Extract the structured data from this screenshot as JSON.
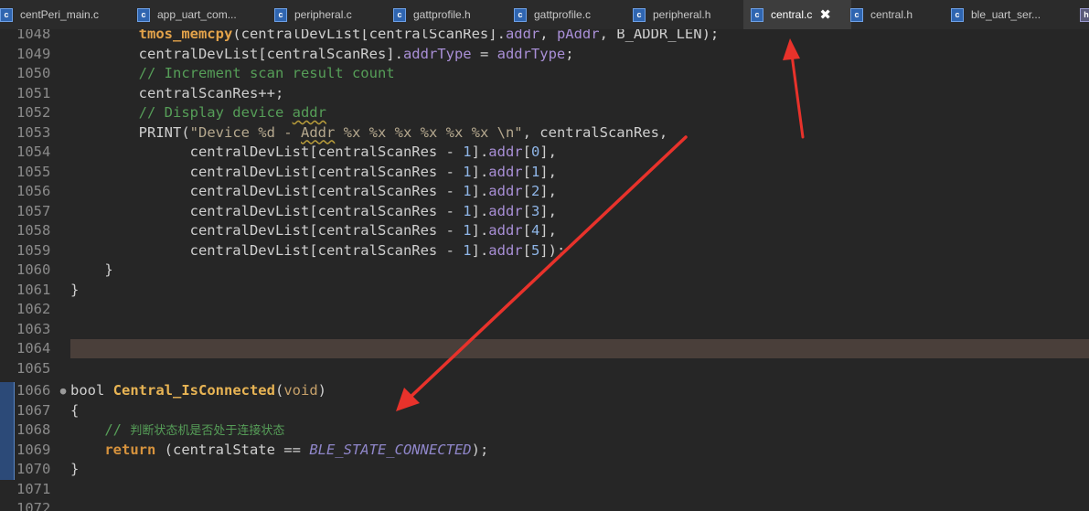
{
  "tabs": [
    {
      "label": "centPeri_main.c",
      "icon": "c-file-icon",
      "active": false
    },
    {
      "label": "app_uart_com...",
      "icon": "c-file-icon",
      "active": false
    },
    {
      "label": "peripheral.c",
      "icon": "c-file-icon",
      "active": false
    },
    {
      "label": "gattprofile.h",
      "icon": "c-file-icon",
      "active": false
    },
    {
      "label": "gattprofile.c",
      "icon": "c-file-icon",
      "active": false
    },
    {
      "label": "peripheral.h",
      "icon": "c-file-icon",
      "active": false
    },
    {
      "label": "central.c",
      "icon": "c-file-icon",
      "active": true,
      "close": "✖"
    },
    {
      "label": "central.h",
      "icon": "c-file-icon",
      "active": false
    },
    {
      "label": "ble_uart_ser...",
      "icon": "c-file-icon",
      "active": false
    },
    {
      "label": "",
      "icon": "h-file-icon",
      "active": false
    }
  ],
  "editor": {
    "line_numbers": [
      "1048",
      "1049",
      "1050",
      "1051",
      "1052",
      "1053",
      "1054",
      "1055",
      "1056",
      "1057",
      "1058",
      "1059",
      "1060",
      "1061",
      "1062",
      "1063",
      "1064",
      "1065",
      "1066",
      "1067",
      "1068",
      "1069",
      "1070",
      "1071",
      "1072"
    ],
    "current_line_index": 16,
    "fold_marker": "●",
    "tokens": {
      "l1048": [
        "        ",
        "tmos_memcpy",
        "(centralDevList[centralScanRes].",
        "addr",
        ", ",
        "pAddr",
        ", B_ADDR_LEN);"
      ],
      "l1049": [
        "        centralDevList[centralScanRes].",
        "addrType",
        " = ",
        "addrType",
        ";"
      ],
      "l1050": [
        "        ",
        "// Increment scan result count"
      ],
      "l1051": [
        "        centralScanRes++;"
      ],
      "l1052": [
        "        ",
        "// Display device ",
        "addr"
      ],
      "l1053": [
        "        PRINT(",
        "\"Device %d - ",
        "Addr",
        " %x %x %x %x %x %x \\n\"",
        ", centralScanRes,"
      ],
      "l1054": [
        "              centralDevList[centralScanRes - ",
        "1",
        "].",
        "addr",
        "[",
        "0",
        "],"
      ],
      "l1055": [
        "              centralDevList[centralScanRes - ",
        "1",
        "].",
        "addr",
        "[",
        "1",
        "],"
      ],
      "l1056": [
        "              centralDevList[centralScanRes - ",
        "1",
        "].",
        "addr",
        "[",
        "2",
        "],"
      ],
      "l1057": [
        "              centralDevList[centralScanRes - ",
        "1",
        "].",
        "addr",
        "[",
        "3",
        "],"
      ],
      "l1058": [
        "              centralDevList[centralScanRes - ",
        "1",
        "].",
        "addr",
        "[",
        "4",
        "],"
      ],
      "l1059": [
        "              centralDevList[centralScanRes - ",
        "1",
        "].",
        "addr",
        "[",
        "5",
        "]);"
      ],
      "l1060": [
        "    }"
      ],
      "l1061": [
        "}"
      ],
      "l1066": [
        "bool ",
        "Central_IsConnected",
        "(",
        "void",
        ")"
      ],
      "l1067": [
        "{"
      ],
      "l1068": [
        "    ",
        "// ",
        "判断状态机是否处于连接状态"
      ],
      "l1069": [
        "    ",
        "return",
        " (centralState == ",
        "BLE_STATE_CONNECTED",
        ");"
      ],
      "l1070": [
        "}"
      ]
    }
  },
  "colors": {
    "background": "#262626",
    "arrow": "#e8322b",
    "keyword": "#d7933d",
    "comment": "#569e58",
    "current_line": "#4a3f3a"
  }
}
